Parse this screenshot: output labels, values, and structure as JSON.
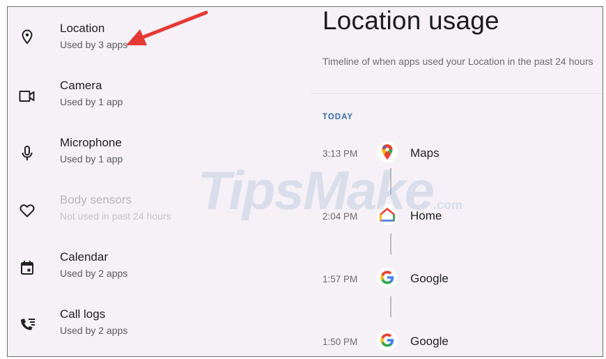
{
  "permissions": [
    {
      "title": "Location",
      "subtitle": "Used by 3 apps",
      "icon": "location-pin-icon"
    },
    {
      "title": "Camera",
      "subtitle": "Used by 1 app",
      "icon": "camera-icon"
    },
    {
      "title": "Microphone",
      "subtitle": "Used by 1 app",
      "icon": "microphone-icon"
    },
    {
      "title": "Body sensors",
      "subtitle": "Not used in past 24 hours",
      "icon": "heart-icon"
    },
    {
      "title": "Calendar",
      "subtitle": "Used by 2 apps",
      "icon": "calendar-icon"
    },
    {
      "title": "Call logs",
      "subtitle": "Used by 2 apps",
      "icon": "call-log-icon"
    }
  ],
  "usage": {
    "title": "Location usage",
    "description": "Timeline of when apps used your Location in the past 24 hours",
    "section_label": "TODAY",
    "entries": [
      {
        "time": "3:13 PM",
        "app": "Maps",
        "icon": "google-maps-icon"
      },
      {
        "time": "2:04 PM",
        "app": "Home",
        "icon": "google-home-icon"
      },
      {
        "time": "1:57 PM",
        "app": "Google",
        "icon": "google-icon"
      },
      {
        "time": "1:50 PM",
        "app": "Google",
        "icon": "google-icon"
      }
    ]
  },
  "watermark": {
    "text": "TipsMake",
    "domain": ".com"
  },
  "colors": {
    "arrow": "#e53935",
    "section_label": "#3b6aa8",
    "background": "#f5f1f6"
  }
}
